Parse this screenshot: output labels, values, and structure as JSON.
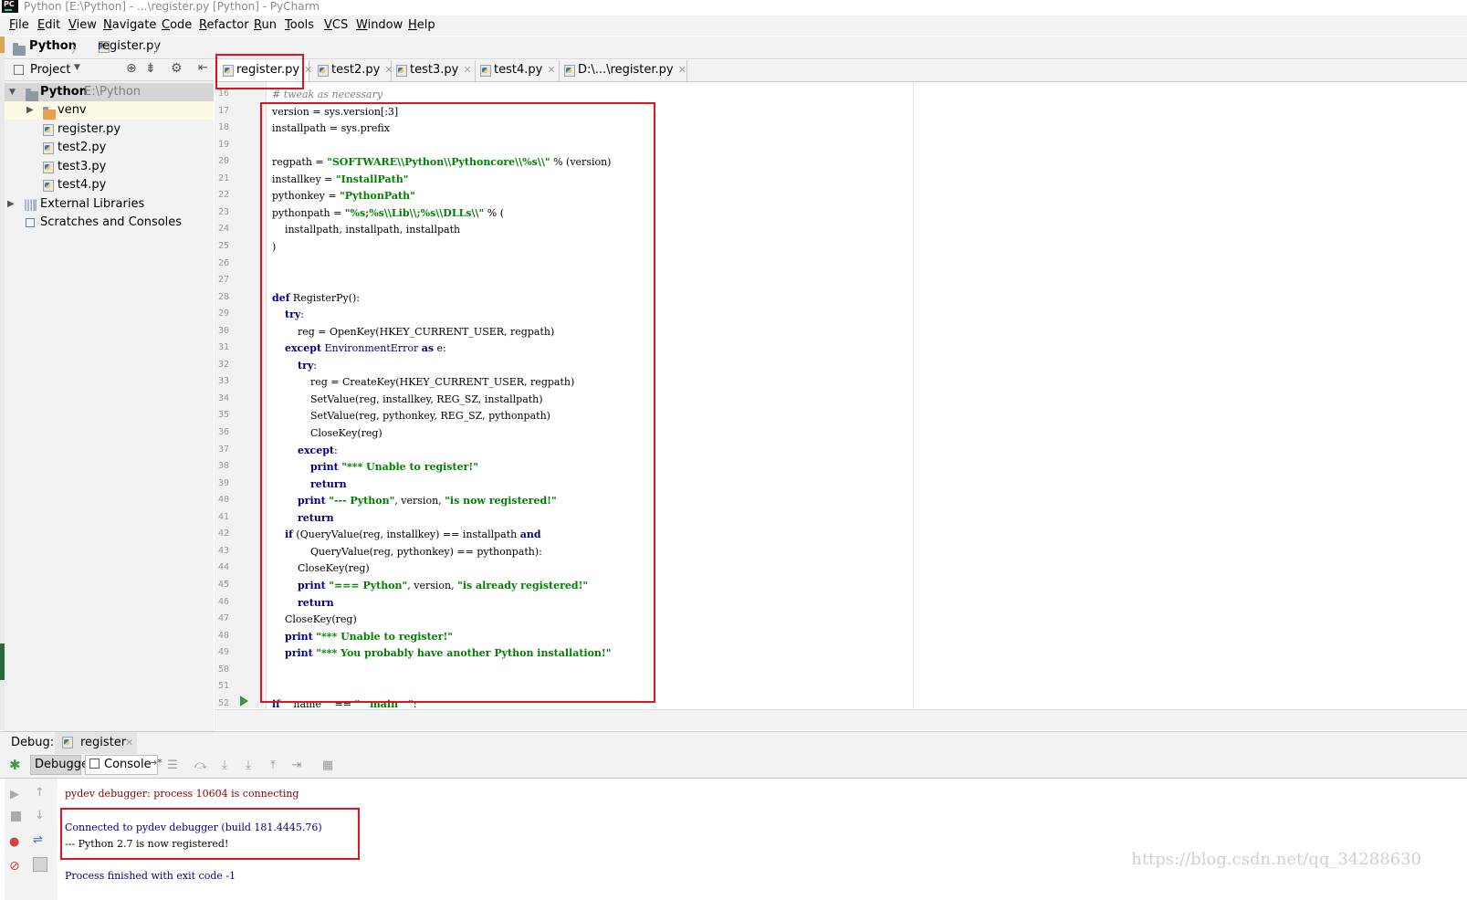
{
  "window": {
    "title": "Python [E:\\Python] - ...\\register.py [Python] - PyCharm",
    "app_icon": "PC"
  },
  "menu": [
    "File",
    "Edit",
    "View",
    "Navigate",
    "Code",
    "Refactor",
    "Run",
    "Tools",
    "VCS",
    "Window",
    "Help"
  ],
  "breadcrumb": {
    "project": "Python",
    "file": "register.py"
  },
  "project_panel": {
    "title": "Project",
    "root": {
      "name": "Python",
      "path": "E:\\Python"
    },
    "items": [
      "venv",
      "register.py",
      "test2.py",
      "test3.py",
      "test4.py"
    ],
    "external": "External Libraries",
    "scratches": "Scratches and Consoles"
  },
  "tabs": [
    "register.py",
    "test2.py",
    "test3.py",
    "test4.py",
    "D:\\...\\register.py"
  ],
  "editor": {
    "line_numbers": [
      "16",
      "17",
      "18",
      "19",
      "20",
      "21",
      "22",
      "23",
      "24",
      "25",
      "26",
      "27",
      "28",
      "29",
      "30",
      "31",
      "32",
      "33",
      "34",
      "35",
      "36",
      "37",
      "38",
      "39",
      "40",
      "41",
      "42",
      "43",
      "44",
      "45",
      "46",
      "47",
      "48",
      "49",
      "50",
      "51",
      "52"
    ],
    "lines": [
      [
        {
          "t": "# tweak as necessary",
          "c": "cm"
        }
      ],
      [
        {
          "t": "version = sys.version[:3]",
          "c": ""
        }
      ],
      [
        {
          "t": "installpath = sys.prefix",
          "c": ""
        }
      ],
      [],
      [
        {
          "t": "regpath = ",
          "c": ""
        },
        {
          "t": "\"SOFTWARE\\\\Python\\\\Pythoncore\\\\%s\\\\\"",
          "c": "st"
        },
        {
          "t": " % (version)",
          "c": ""
        }
      ],
      [
        {
          "t": "installkey = ",
          "c": ""
        },
        {
          "t": "\"InstallPath\"",
          "c": "st"
        }
      ],
      [
        {
          "t": "pythonkey = ",
          "c": ""
        },
        {
          "t": "\"PythonPath\"",
          "c": "st"
        }
      ],
      [
        {
          "t": "pythonpath = ",
          "c": ""
        },
        {
          "t": "\"%s;%s\\\\Lib\\\\;%s\\\\DLLs\\\\\"",
          "c": "st"
        },
        {
          "t": " % (",
          "c": ""
        }
      ],
      [
        {
          "t": "    installpath, installpath, installpath",
          "c": ""
        }
      ],
      [
        {
          "t": ")",
          "c": ""
        }
      ],
      [],
      [],
      [
        {
          "t": "def",
          "c": "kw"
        },
        {
          "t": " RegisterPy():",
          "c": ""
        }
      ],
      [
        {
          "t": "    ",
          "c": ""
        },
        {
          "t": "try",
          "c": "kw"
        },
        {
          "t": ":",
          "c": ""
        }
      ],
      [
        {
          "t": "        reg = OpenKey(HKEY_CURRENT_USER, regpath)",
          "c": ""
        }
      ],
      [
        {
          "t": "    ",
          "c": ""
        },
        {
          "t": "except",
          "c": "kw"
        },
        {
          "t": " ",
          "c": ""
        },
        {
          "t": "EnvironmentError",
          "c": "bi"
        },
        {
          "t": " ",
          "c": ""
        },
        {
          "t": "as",
          "c": "kw"
        },
        {
          "t": " e:",
          "c": ""
        }
      ],
      [
        {
          "t": "        ",
          "c": ""
        },
        {
          "t": "try",
          "c": "kw"
        },
        {
          "t": ":",
          "c": ""
        }
      ],
      [
        {
          "t": "            reg = CreateKey(HKEY_CURRENT_USER, regpath)",
          "c": ""
        }
      ],
      [
        {
          "t": "            SetValue(reg, installkey, REG_SZ, installpath)",
          "c": ""
        }
      ],
      [
        {
          "t": "            SetValue(reg, pythonkey, REG_SZ, pythonpath)",
          "c": ""
        }
      ],
      [
        {
          "t": "            CloseKey(reg)",
          "c": ""
        }
      ],
      [
        {
          "t": "        ",
          "c": ""
        },
        {
          "t": "except",
          "c": "kw"
        },
        {
          "t": ":",
          "c": ""
        }
      ],
      [
        {
          "t": "            ",
          "c": ""
        },
        {
          "t": "print",
          "c": "kw"
        },
        {
          "t": " ",
          "c": ""
        },
        {
          "t": "\"*** Unable to register!\"",
          "c": "st"
        }
      ],
      [
        {
          "t": "            ",
          "c": ""
        },
        {
          "t": "return",
          "c": "kw"
        }
      ],
      [
        {
          "t": "        ",
          "c": ""
        },
        {
          "t": "print",
          "c": "kw"
        },
        {
          "t": " ",
          "c": ""
        },
        {
          "t": "\"--- Python\"",
          "c": "st"
        },
        {
          "t": ", version, ",
          "c": ""
        },
        {
          "t": "\"is now registered!\"",
          "c": "st"
        }
      ],
      [
        {
          "t": "        ",
          "c": ""
        },
        {
          "t": "return",
          "c": "kw"
        }
      ],
      [
        {
          "t": "    ",
          "c": ""
        },
        {
          "t": "if",
          "c": "kw"
        },
        {
          "t": " (QueryValue(reg, installkey) == installpath ",
          "c": ""
        },
        {
          "t": "and",
          "c": "kw"
        }
      ],
      [
        {
          "t": "            QueryValue(reg, pythonkey) == pythonpath):",
          "c": ""
        }
      ],
      [
        {
          "t": "        CloseKey(reg)",
          "c": ""
        }
      ],
      [
        {
          "t": "        ",
          "c": ""
        },
        {
          "t": "print",
          "c": "kw"
        },
        {
          "t": " ",
          "c": ""
        },
        {
          "t": "\"=== Python\"",
          "c": "st"
        },
        {
          "t": ", version, ",
          "c": ""
        },
        {
          "t": "\"is already registered!\"",
          "c": "st"
        }
      ],
      [
        {
          "t": "        ",
          "c": ""
        },
        {
          "t": "return",
          "c": "kw"
        }
      ],
      [
        {
          "t": "    CloseKey(reg)",
          "c": ""
        }
      ],
      [
        {
          "t": "    ",
          "c": ""
        },
        {
          "t": "print",
          "c": "kw"
        },
        {
          "t": " ",
          "c": ""
        },
        {
          "t": "\"*** Unable to register!\"",
          "c": "st"
        }
      ],
      [
        {
          "t": "    ",
          "c": ""
        },
        {
          "t": "print",
          "c": "kw"
        },
        {
          "t": " ",
          "c": ""
        },
        {
          "t": "\"*** You probably have another Python installation!\"",
          "c": "st"
        }
      ],
      [],
      [],
      [
        {
          "t": "if",
          "c": "kw"
        },
        {
          "t": " __name__ == ",
          "c": ""
        },
        {
          "t": "\"__main__\"",
          "c": "st"
        },
        {
          "t": ":",
          "c": ""
        }
      ]
    ]
  },
  "debug": {
    "label": "Debug:",
    "session": "register",
    "tab_debugger": "Debugger",
    "tab_console": "Console",
    "console_lines": [
      {
        "t": "pydev debugger: process 10604 is connecting",
        "color": "#8b0000"
      },
      {
        "t": "",
        "color": "#000000"
      },
      {
        "t": "Connected to pydev debugger (build 181.4445.76)",
        "color": "#000080"
      },
      {
        "t": "--- Python 2.7 is now registered!",
        "color": "#000000"
      },
      {
        "t": "",
        "color": "#000000"
      },
      {
        "t": "Process finished with exit code -1",
        "color": "#000080"
      }
    ]
  },
  "watermark": "https://blog.csdn.net/qq_34288630",
  "colors": {
    "annotation_red": "#e0141e",
    "keyword": "#000080",
    "string": "#008000"
  }
}
